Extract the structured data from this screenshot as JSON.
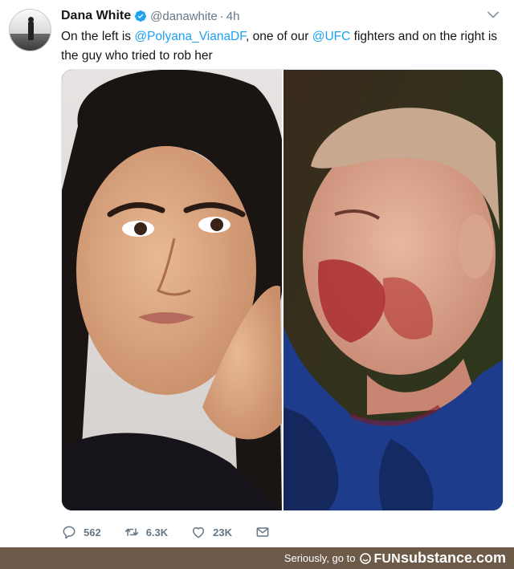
{
  "tweet": {
    "author_name": "Dana White",
    "handle": "@danawhite",
    "separator": "·",
    "time": "4h",
    "text_parts": {
      "t1": "On the left is ",
      "m1": "@Polyana_VianaDF",
      "t2": ", one of our ",
      "m2": "@UFC",
      "t3": " fighters and on the right is the guy who tried to rob her"
    },
    "actions": {
      "reply_count": "562",
      "retweet_count": "6.3K",
      "like_count": "23K"
    }
  },
  "footer": {
    "text": "Seriously, go to",
    "brand_fun": "FUN",
    "brand_substance": "substance",
    "brand_suffix": ".com"
  },
  "colors": {
    "link": "#1da1f2",
    "muted": "#657786",
    "verified": "#1da1f2",
    "footer_bg": "#6e5a49"
  },
  "icons": [
    "verified-badge-icon",
    "chevron-down-icon",
    "reply-icon",
    "retweet-icon",
    "like-icon",
    "direct-message-icon",
    "funsubstance-logo-icon"
  ]
}
